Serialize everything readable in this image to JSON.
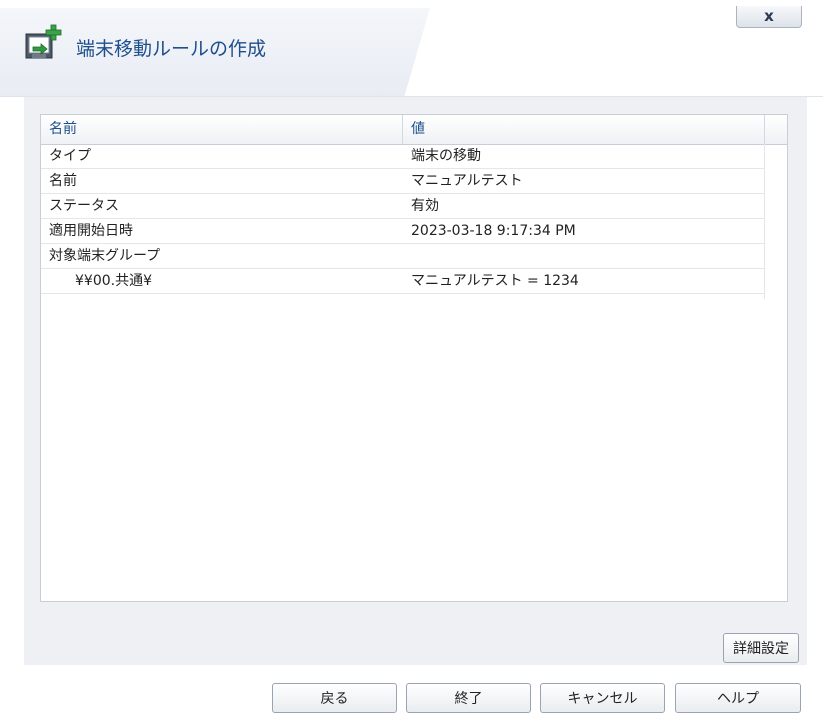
{
  "dialog": {
    "title": "端末移動ルールの作成",
    "close_label": "x"
  },
  "table": {
    "headers": {
      "name": "名前",
      "value": "値"
    },
    "rows": [
      {
        "name": "タイプ",
        "value": "端末の移動"
      },
      {
        "name": "名前",
        "value": "マニュアルテスト"
      },
      {
        "name": "ステータス",
        "value": "有効"
      },
      {
        "name": "適用開始日時",
        "value": "2023-03-18 9:17:34 PM"
      },
      {
        "name": "対象端末グループ",
        "value": ""
      },
      {
        "name": "¥¥00.共通¥",
        "value": "マニュアルテスト = 1234"
      }
    ]
  },
  "buttons": {
    "advanced": "詳細設定",
    "back": "戻る",
    "finish": "終了",
    "cancel": "キャンセル",
    "help": "ヘルプ"
  },
  "icons": {
    "title_icon": "computer-add-arrow-icon"
  },
  "colors": {
    "title": "#1f4e8c",
    "header_text": "#1f4e8c",
    "icon_plus": "#3aa34a"
  }
}
